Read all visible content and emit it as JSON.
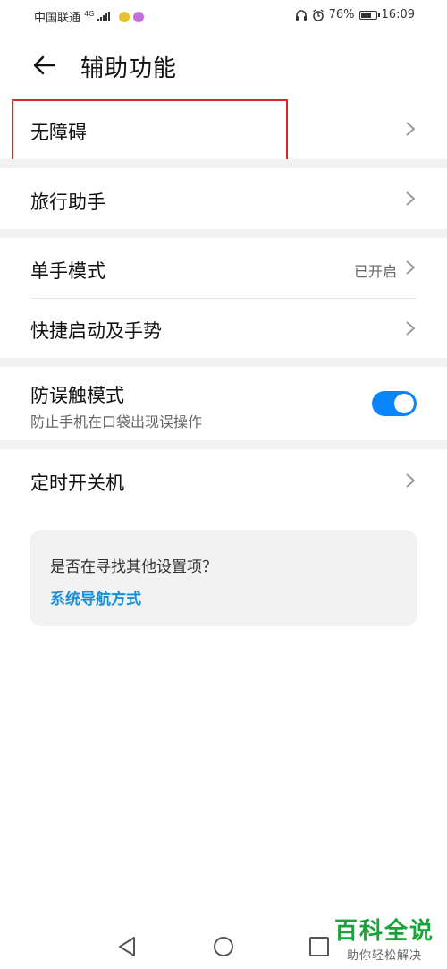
{
  "status_bar": {
    "carrier": "中国联通",
    "network": "4G",
    "battery_pct": "76%",
    "battery_level": 0.76,
    "time": "16:09",
    "icons": [
      "signal-icon",
      "app-notification-icon",
      "headset-icon",
      "alarm-icon",
      "battery-icon"
    ]
  },
  "header": {
    "title": "辅助功能",
    "back_icon": "arrow-left-icon"
  },
  "rows": {
    "accessibility": {
      "label": "无障碍"
    },
    "travel_assistant": {
      "label": "旅行助手"
    },
    "one_hand_mode": {
      "label": "单手模式",
      "value": "已开启"
    },
    "quick_launch": {
      "label": "快捷启动及手势"
    },
    "pocket_mode": {
      "label": "防误触模式",
      "sub": "防止手机在口袋出现误操作",
      "enabled": true
    },
    "scheduled_power": {
      "label": "定时开关机"
    }
  },
  "suggestion": {
    "question": "是否在寻找其他设置项？",
    "link": "系统导航方式"
  },
  "colors": {
    "accent": "#0a84ff",
    "link": "#1a8fd8",
    "highlight": "#d9252e",
    "watermark": "#1aa33a"
  },
  "watermark": {
    "big": "百科全说",
    "small": "助你轻松解决"
  }
}
